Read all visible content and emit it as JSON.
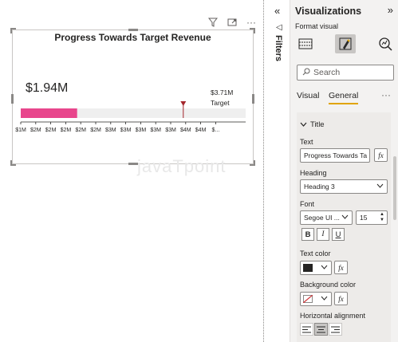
{
  "visual": {
    "title": "Progress Towards Target Revenue",
    "value_label": "$1.94M",
    "target_value_label": "$3.71M",
    "target_word": "Target",
    "watermark": "javaTpoint"
  },
  "chart_data": {
    "type": "bar",
    "orientation": "horizontal",
    "title": "Progress Towards Target Revenue",
    "series": [
      {
        "name": "",
        "values": [
          1.94
        ]
      }
    ],
    "target": 3.71,
    "unit": "$M",
    "xlim": [
      1.0,
      4.75
    ],
    "x_ticks": [
      "$1M",
      "$2M",
      "$2M",
      "$2M",
      "$2M",
      "$2M",
      "$3M",
      "$3M",
      "$3M",
      "$3M",
      "$3M",
      "$4M",
      "$4M",
      "$..."
    ],
    "x_tick_values": [
      1.0,
      1.25,
      1.5,
      1.75,
      2.0,
      2.25,
      2.5,
      2.75,
      3.0,
      3.25,
      3.5,
      3.75,
      4.0,
      4.25
    ],
    "colors": {
      "bar": "#e8468c",
      "track": "#efefef",
      "target": "#a4262c"
    }
  },
  "filters_pane": {
    "label": "Filters"
  },
  "viz_pane": {
    "title": "Visualizations",
    "subtitle": "Format visual",
    "search_placeholder": "Search",
    "tab_visual": "Visual",
    "tab_general": "General",
    "section_title": "Title",
    "text_label": "Text",
    "text_value": "Progress Towards Ta",
    "heading_label": "Heading",
    "heading_value": "Heading 3",
    "font_label": "Font",
    "font_value": "Segoe UI ...",
    "font_size": "15",
    "bold": "B",
    "italic": "I",
    "underline": "U",
    "text_color_label": "Text color",
    "text_color": "#252423",
    "bg_color_label": "Background color",
    "h_align_label": "Horizontal alignment",
    "fx": "fx"
  }
}
